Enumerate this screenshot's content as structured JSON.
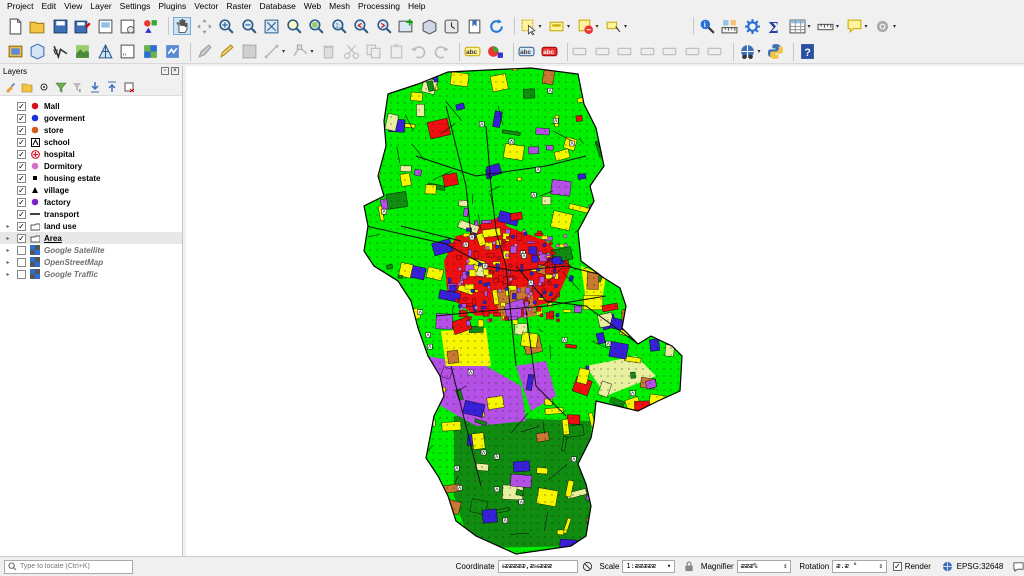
{
  "menu": {
    "items": [
      "Project",
      "Edit",
      "View",
      "Layer",
      "Settings",
      "Plugins",
      "Vector",
      "Raster",
      "Database",
      "Web",
      "Mesh",
      "Processing",
      "Help"
    ]
  },
  "layers_panel": {
    "title": "Layers",
    "layers": [
      {
        "name": "Mall",
        "checked": true,
        "symbol": "dot",
        "color": "#d4141c",
        "expandable": false,
        "style": "bold"
      },
      {
        "name": "goverment",
        "checked": true,
        "symbol": "dot",
        "color": "#1a2fd6",
        "expandable": false,
        "style": "bold"
      },
      {
        "name": "store",
        "checked": true,
        "symbol": "dot",
        "color": "#d25a1c",
        "expandable": false,
        "style": "bold"
      },
      {
        "name": "school",
        "checked": true,
        "symbol": "school",
        "color": "#000000",
        "expandable": false,
        "style": "bold"
      },
      {
        "name": "hospital",
        "checked": true,
        "symbol": "hospital",
        "color": "#e0182c",
        "expandable": false,
        "style": "bold"
      },
      {
        "name": "Dormitory",
        "checked": true,
        "symbol": "dot",
        "color": "#d470c8",
        "expandable": false,
        "style": "bold"
      },
      {
        "name": "housing estate",
        "checked": true,
        "symbol": "square",
        "color": "#000000",
        "expandable": false,
        "style": "bold"
      },
      {
        "name": "village",
        "checked": true,
        "symbol": "triangle",
        "color": "#000000",
        "expandable": false,
        "style": "bold"
      },
      {
        "name": "factory",
        "checked": true,
        "symbol": "dot",
        "color": "#7a22c8",
        "expandable": false,
        "style": "bold"
      },
      {
        "name": "transport",
        "checked": true,
        "symbol": "line",
        "color": "#000000",
        "expandable": false,
        "style": "bold"
      },
      {
        "name": "land use",
        "checked": true,
        "symbol": "polygon",
        "color": "#ffffff",
        "expandable": true,
        "style": "bold"
      },
      {
        "name": "Area",
        "checked": true,
        "symbol": "polygon",
        "color": "#ffffff",
        "expandable": true,
        "style": "bold-underline"
      },
      {
        "name": "Google Satellite",
        "checked": false,
        "symbol": "raster",
        "color": "#333333",
        "expandable": true,
        "style": "italic"
      },
      {
        "name": "OpenStreetMap",
        "checked": false,
        "symbol": "raster",
        "color": "#333333",
        "expandable": true,
        "style": "italic"
      },
      {
        "name": "Google Traffic",
        "checked": false,
        "symbol": "raster",
        "color": "#333333",
        "expandable": true,
        "style": "italic"
      }
    ]
  },
  "map": {
    "colors": {
      "green": "#00ef00",
      "darkgreen": "#108c10",
      "red": "#ee1010",
      "yellow": "#f6f600",
      "purple": "#b550e6",
      "brown": "#c87832",
      "blue": "#3820d8",
      "khaki": "#e8f0a0"
    }
  },
  "statusbar": {
    "locator_placeholder": "Type to locate (Ctrl+K)",
    "coordinate_label": "Coordinate",
    "coordinate_value": "ᵴᴂᴂᴂᴂᴂ,ᴂᵴᵴᴂᴂᴂ",
    "scale_label": "Scale",
    "scale_value": "1:ᴂᴂᴂᴂᴂ",
    "magnifier_label": "Magnifier",
    "magnifier_value": "ᴂᴂᴂ%",
    "rotation_label": "Rotation",
    "rotation_value": "ᴂ.ᴂ °",
    "render_label": "Render",
    "crs_label": "EPSG:32648"
  }
}
